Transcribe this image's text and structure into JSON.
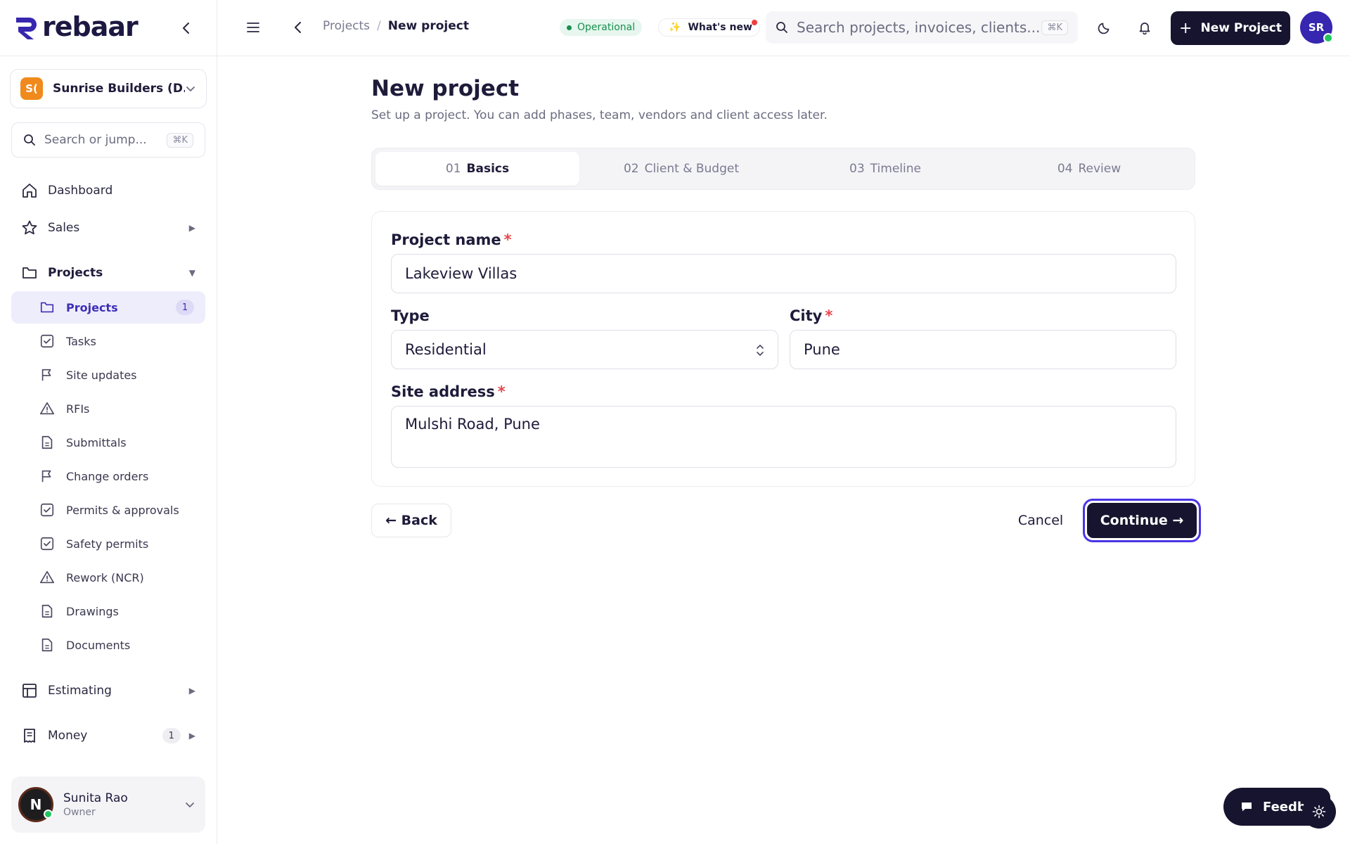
{
  "app": {
    "name": "rebaar"
  },
  "org": {
    "initials": "S(",
    "name": "Sunrise Builders (D..."
  },
  "sidebar": {
    "search_placeholder": "Search or jump...",
    "search_shortcut": "⌘K",
    "dashboard": "Dashboard",
    "sales": "Sales",
    "projects_group": "Projects",
    "sub_items": [
      {
        "label": "Projects",
        "badge": "1"
      },
      {
        "label": "Tasks"
      },
      {
        "label": "Site updates"
      },
      {
        "label": "RFIs"
      },
      {
        "label": "Submittals"
      },
      {
        "label": "Change orders"
      },
      {
        "label": "Permits & approvals"
      },
      {
        "label": "Safety permits"
      },
      {
        "label": "Rework (NCR)"
      },
      {
        "label": "Drawings"
      },
      {
        "label": "Documents"
      }
    ],
    "estimating": "Estimating",
    "money": "Money",
    "money_badge": "1"
  },
  "user": {
    "initial": "N",
    "name": "Sunita Rao",
    "role": "Owner"
  },
  "topbar": {
    "breadcrumb_parent": "Projects",
    "breadcrumb_sep": "/",
    "breadcrumb_current": "New project",
    "status": "Operational",
    "whats_new": "What's new",
    "search_placeholder": "Search projects, invoices, clients...",
    "search_shortcut": "⌘K",
    "new_project_label": "New Project",
    "avatar_initials": "SR"
  },
  "page": {
    "title": "New project",
    "subtitle": "Set up a project. You can add phases, team, vendors and client access later."
  },
  "steps": [
    {
      "num": "01",
      "label": "Basics"
    },
    {
      "num": "02",
      "label": "Client & Budget"
    },
    {
      "num": "03",
      "label": "Timeline"
    },
    {
      "num": "04",
      "label": "Review"
    }
  ],
  "form": {
    "project_name_label": "Project name",
    "project_name_value": "Lakeview Villas",
    "type_label": "Type",
    "type_value": "Residential",
    "city_label": "City",
    "city_value": "Pune",
    "site_address_label": "Site address",
    "site_address_value": "Mulshi Road, Pune",
    "required_mark": "*"
  },
  "actions": {
    "back": "← Back",
    "cancel": "Cancel",
    "continue": "Continue →"
  },
  "feedback": {
    "label": "Feedba"
  },
  "colors": {
    "brand": "#1c1842",
    "accent": "#3d2fb8",
    "primary_button": "#16142e",
    "status_green": "#17904f",
    "required_red": "#e5484d",
    "focus_ring": "#4a34e6"
  }
}
